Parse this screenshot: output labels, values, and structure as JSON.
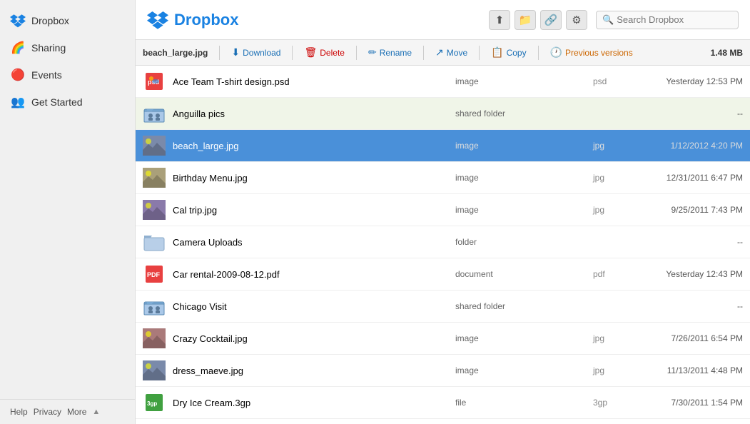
{
  "sidebar": {
    "title": "Dropbox",
    "items": [
      {
        "id": "dropbox",
        "label": "Dropbox",
        "icon": "📦",
        "color": "#1a82e2"
      },
      {
        "id": "sharing",
        "label": "Sharing",
        "icon": "🌈"
      },
      {
        "id": "events",
        "label": "Events",
        "icon": "🔴"
      },
      {
        "id": "get-started",
        "label": "Get Started",
        "icon": "👥"
      }
    ],
    "footer": {
      "links": [
        "Help",
        "Privacy",
        "More"
      ],
      "arrow": "▲"
    }
  },
  "header": {
    "logo": "Dropbox",
    "search_placeholder": "Search Dropbox",
    "icons": [
      "upload",
      "folder-new",
      "folder-link",
      "settings"
    ]
  },
  "toolbar": {
    "breadcrumb": "beach_large.jpg",
    "download_label": "Download",
    "delete_label": "Delete",
    "rename_label": "Rename",
    "move_label": "Move",
    "copy_label": "Copy",
    "prev_versions_label": "Previous versions",
    "file_size": "1.48 MB"
  },
  "files": [
    {
      "name": "Ace Team T-shirt design.psd",
      "type": "image",
      "ext": "psd",
      "date": "Yesterday 12:53 PM",
      "icon": "🖼️",
      "selected": false,
      "highlighted": false
    },
    {
      "name": "Anguilla pics",
      "type": "shared folder",
      "ext": "",
      "date": "--",
      "icon": "👥📁",
      "selected": false,
      "highlighted": true
    },
    {
      "name": "beach_large.jpg",
      "type": "image",
      "ext": "jpg",
      "date": "1/12/2012 4:20 PM",
      "icon": "🏖️",
      "selected": true,
      "highlighted": false
    },
    {
      "name": "Birthday Menu.jpg",
      "type": "image",
      "ext": "jpg",
      "date": "12/31/2011 6:47 PM",
      "icon": "🖼️",
      "selected": false,
      "highlighted": false
    },
    {
      "name": "Cal trip.jpg",
      "type": "image",
      "ext": "jpg",
      "date": "9/25/2011 7:43 PM",
      "icon": "🖼️",
      "selected": false,
      "highlighted": false
    },
    {
      "name": "Camera Uploads",
      "type": "folder",
      "ext": "",
      "date": "--",
      "icon": "📁",
      "selected": false,
      "highlighted": false
    },
    {
      "name": "Car rental-2009-08-12.pdf",
      "type": "document",
      "ext": "pdf",
      "date": "Yesterday 12:43 PM",
      "icon": "📄",
      "selected": false,
      "highlighted": false
    },
    {
      "name": "Chicago Visit",
      "type": "shared folder",
      "ext": "",
      "date": "--",
      "icon": "👥📁",
      "selected": false,
      "highlighted": false
    },
    {
      "name": "Crazy Cocktail.jpg",
      "type": "image",
      "ext": "jpg",
      "date": "7/26/2011 6:54 PM",
      "icon": "🖼️",
      "selected": false,
      "highlighted": false
    },
    {
      "name": "dress_maeve.jpg",
      "type": "image",
      "ext": "jpg",
      "date": "11/13/2011 4:48 PM",
      "icon": "🖼️",
      "selected": false,
      "highlighted": false
    },
    {
      "name": "Dry Ice Cream.3gp",
      "type": "file",
      "ext": "3gp",
      "date": "7/30/2011 1:54 PM",
      "icon": "🎬",
      "selected": false,
      "highlighted": false
    }
  ]
}
